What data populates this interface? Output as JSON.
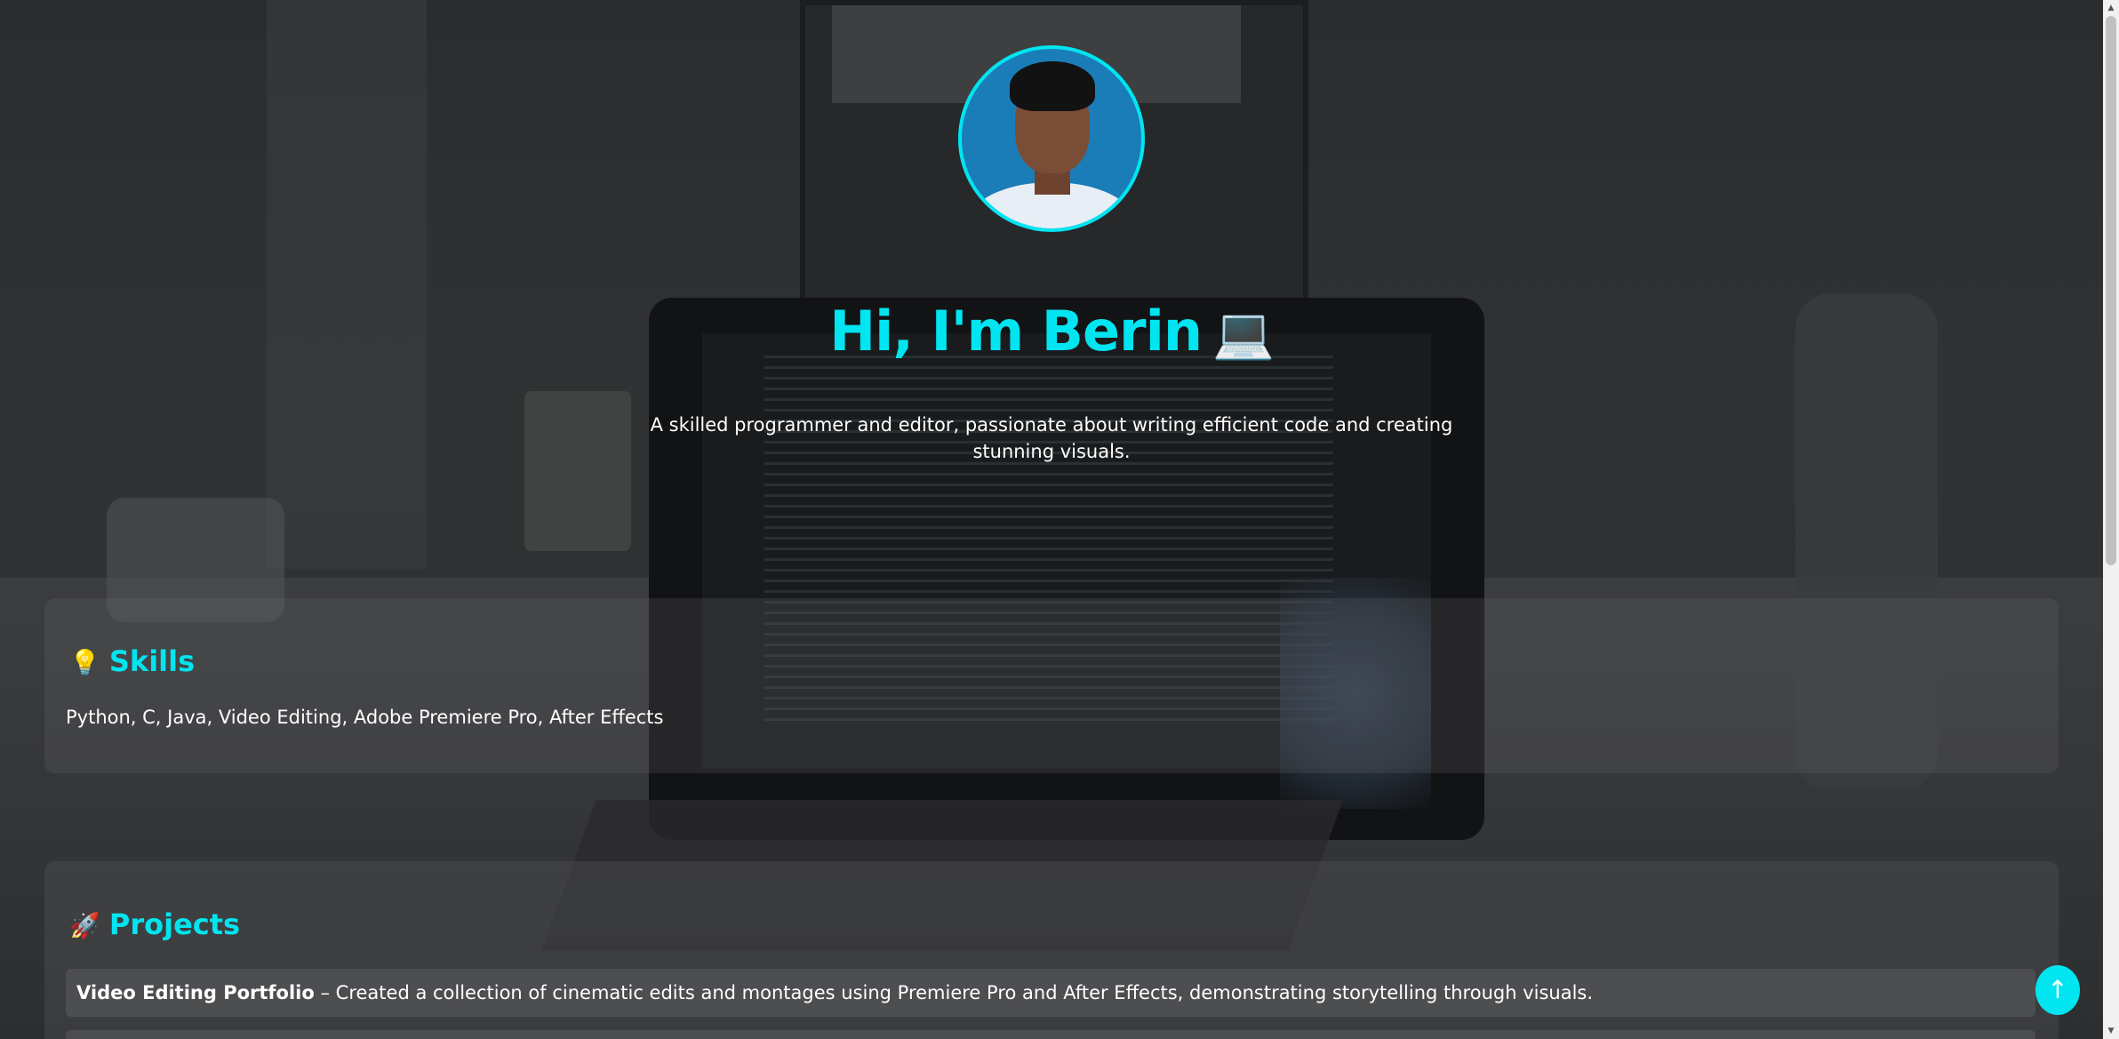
{
  "hero": {
    "title": "Hi, I'm Berin",
    "title_emoji": "💻",
    "tagline": "A skilled programmer and editor, passionate about writing efficient code and creating stunning visuals."
  },
  "skills": {
    "emoji": "💡",
    "heading": "Skills",
    "text": "Python, C, Java, Video Editing, Adobe Premiere Pro, After Effects"
  },
  "projects": {
    "emoji": "🚀",
    "heading": "Projects",
    "items": [
      {
        "name": "Video Editing Portfolio",
        "description": " – Created a collection of cinematic edits and montages using Premiere Pro and After Effects, demonstrating storytelling through visuals."
      },
      {
        "name": "",
        "description": ""
      }
    ]
  },
  "scroll_top": {
    "label": "↑"
  },
  "scrollbar": {
    "up": "▲",
    "down": "▼"
  },
  "colors": {
    "accent": "#00e5f0",
    "text": "#ffffff"
  }
}
